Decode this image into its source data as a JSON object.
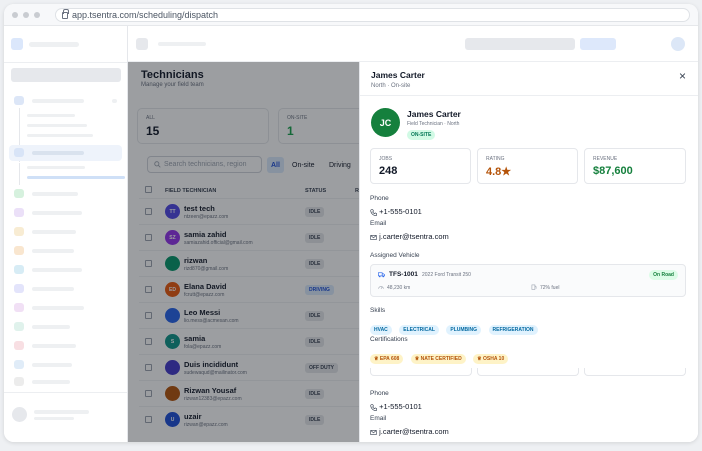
{
  "browser": {
    "url": "app.tsentra.com/scheduling/dispatch"
  },
  "page": {
    "title": "Technicians",
    "subtitle": "Manage your field team"
  },
  "stats": [
    {
      "label": "ALL",
      "value": "15"
    },
    {
      "label": "ON-SITE",
      "value": "1"
    }
  ],
  "search": {
    "placeholder": "Search technicians, region"
  },
  "filters": {
    "all": "All",
    "onsite": "On-site",
    "driving": "Driving"
  },
  "table": {
    "headers": {
      "tech": "FIELD TECHNICIAN",
      "status": "STATUS",
      "extra": "R"
    },
    "rows": [
      {
        "initials": "TT",
        "name": "test tech",
        "email": "ntzeen@epazz.com",
        "status": "IDLE",
        "color": "#4f46e5"
      },
      {
        "initials": "SZ",
        "name": "samia zahid",
        "email": "samiazahid.official@gmail.com",
        "status": "IDLE",
        "color": "#9333ea"
      },
      {
        "initials": "",
        "name": "rizwan",
        "email": "rizd870@gmail.com",
        "status": "IDLE",
        "color": "#059669"
      },
      {
        "initials": "ED",
        "name": "Elana David",
        "email": "fcrutt@epazz.com",
        "status": "DRIVING",
        "color": "#ea580c"
      },
      {
        "initials": "",
        "name": "Leo Messi",
        "email": "lio.mess@acmesan.com",
        "status": "IDLE",
        "color": "#2563eb"
      },
      {
        "initials": "S",
        "name": "samia",
        "email": "fola@epazz.com",
        "status": "IDLE",
        "color": "#0d9488"
      },
      {
        "initials": "",
        "name": "Duis incididunt",
        "email": "sudewaqud@mailinator.com",
        "status": "OFF DUTY",
        "color": "#4338ca"
      },
      {
        "initials": "",
        "name": "Rizwan Yousaf",
        "email": "rizwan12383@epazz.com",
        "status": "IDLE",
        "color": "#b45309"
      },
      {
        "initials": "U",
        "name": "uzair",
        "email": "rizwan@epazz.com",
        "status": "IDLE",
        "color": "#1d4ed8"
      }
    ]
  },
  "panel": {
    "title": "James Carter",
    "subtitle": "North · On-site",
    "close": "×",
    "initials": "JC",
    "name": "James Carter",
    "role": "Field Technician · North",
    "status": "ON-SITE",
    "metrics": [
      {
        "label": "JOBS",
        "value": "248"
      },
      {
        "label": "RATING",
        "value": "4.8★"
      },
      {
        "label": "REVENUE",
        "value": "$87,600"
      }
    ],
    "phone_label": "Phone",
    "phone": "+1-555-0101",
    "email_label": "Email",
    "email": "j.carter@tsentra.com",
    "vehicle_label": "Assigned Vehicle",
    "vehicle": {
      "id": "TFS-1001",
      "model": "2022 Ford Transit 250",
      "status": "On Road",
      "odometer": "48,230 km",
      "fuel": "72% fuel"
    },
    "skills_label": "Skills",
    "skills": [
      "HVAC",
      "ELECTRICAL",
      "PLUMBING",
      "REFRIGERATION"
    ],
    "certs_label": "Certifications",
    "certs": [
      "EPA 608",
      "NATE CERTIFIED",
      "OSHA 10"
    ],
    "phone_label_2": "Phone",
    "phone_2": "+1-555-0101",
    "email_label_2": "Email",
    "email_2": "j.carter@tsentra.com"
  },
  "colors": {
    "accent": "#16a34a",
    "rating": "#b45309",
    "revenue": "#15803d"
  }
}
